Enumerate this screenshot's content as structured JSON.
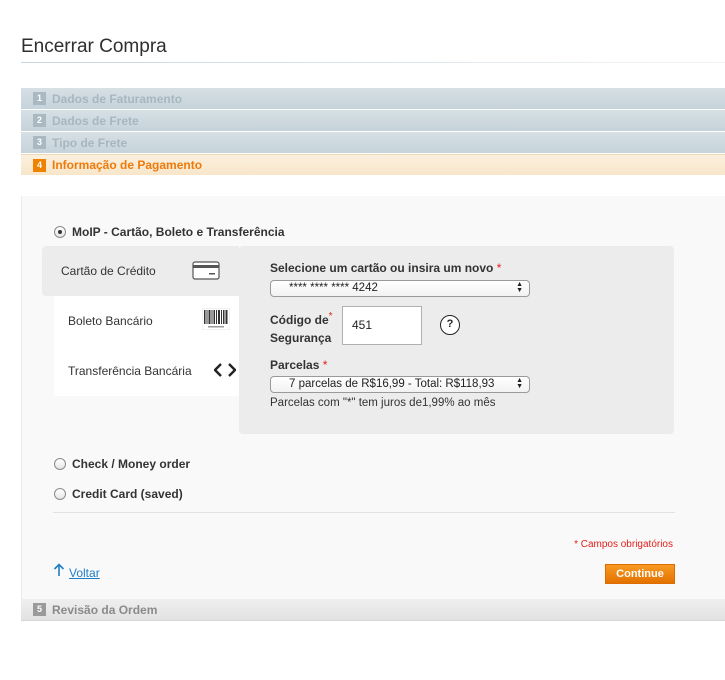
{
  "page": {
    "title": "Encerrar Compra"
  },
  "steps": [
    {
      "num": "1",
      "label": "Dados de Faturamento"
    },
    {
      "num": "2",
      "label": "Dados de Frete"
    },
    {
      "num": "3",
      "label": "Tipo de Frete"
    },
    {
      "num": "4",
      "label": "Informação de Pagamento"
    },
    {
      "num": "5",
      "label": "Revisão da Ordem"
    }
  ],
  "payment": {
    "moip_label": "MoIP - Cartão, Boleto e Transferência",
    "tabs": {
      "credit": "Cartão de Crédito",
      "boleto": "Boleto Bancário",
      "transfer": "Transferência Bancária"
    },
    "card_select_label": "Selecione um cartão ou insira um novo",
    "card_select_value": "**** **** **** 4242",
    "security_code_label_line1": "Código de",
    "security_code_label_line2": "Segurança",
    "security_code_value": "451",
    "help_glyph": "?",
    "installments_label": "Parcelas",
    "installments_value": "7 parcelas de R$16,99 - Total: R$118,93",
    "installments_note": "Parcelas com \"*\" tem juros de1,99% ao mês",
    "required_mark": "*",
    "other_methods": {
      "check": "Check / Money order",
      "saved_card": "Credit Card (saved)"
    },
    "required_fields_note": "* Campos obrigatórios",
    "back_label": "Voltar",
    "continue_label": "Continue"
  },
  "icons": {
    "credit_card": "credit-card-icon",
    "barcode": "barcode-icon",
    "transfer": "arrows-left-right-icon",
    "help": "help-icon",
    "back": "arrow-up-icon"
  },
  "colors": {
    "accent_orange": "#f18200",
    "link_blue": "#1e7ec8",
    "required_red": "#e0201b"
  }
}
